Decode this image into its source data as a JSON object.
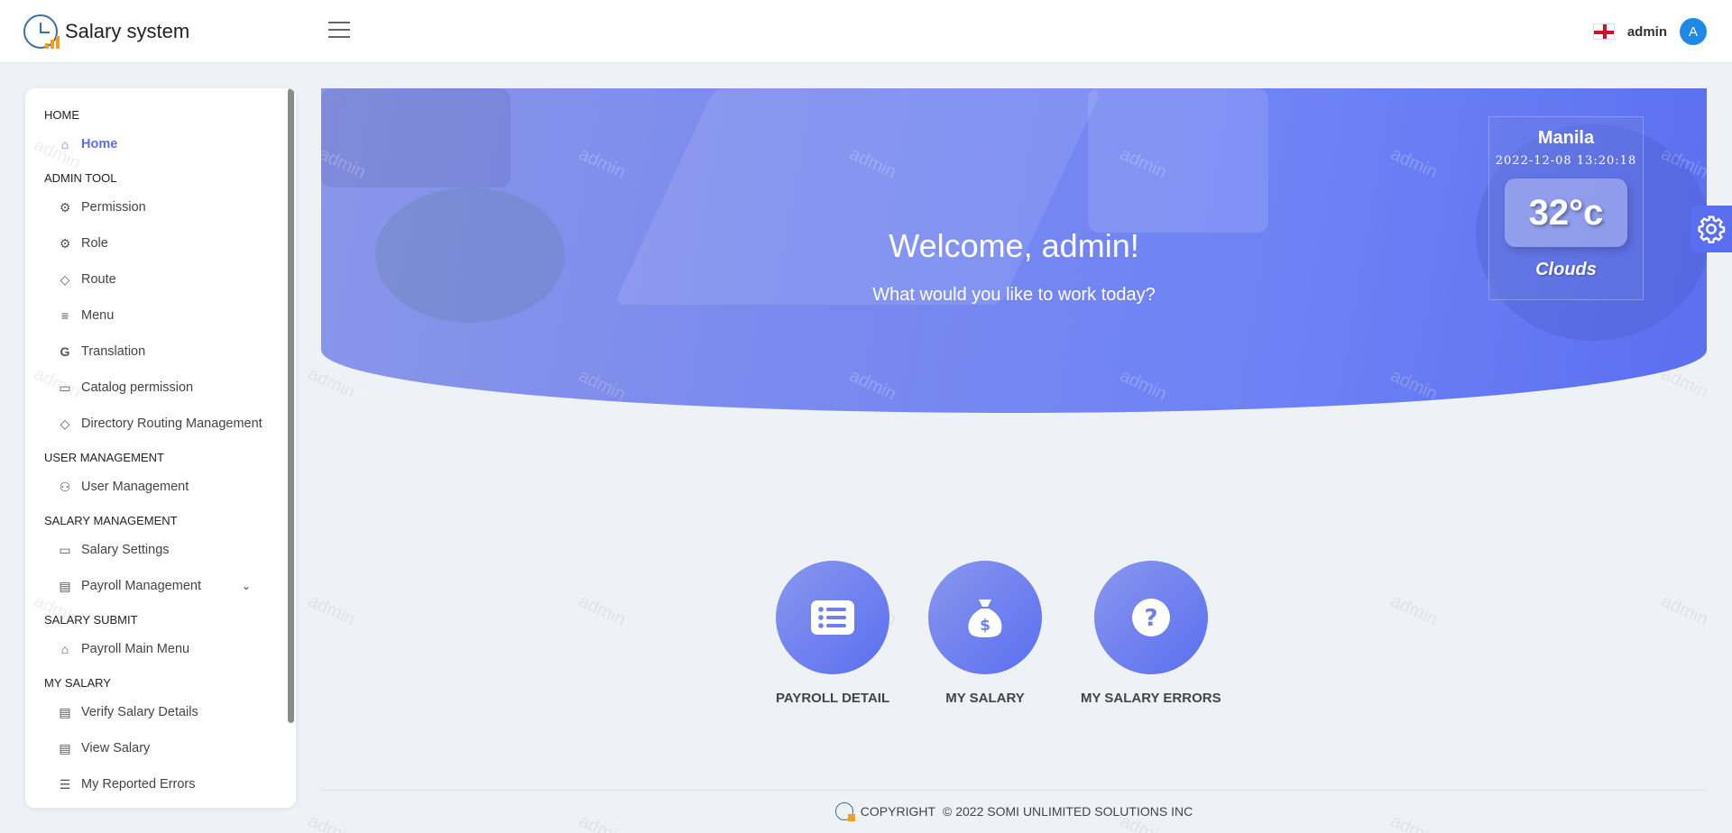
{
  "app": {
    "title": "Salary system"
  },
  "header": {
    "user_name": "admin",
    "avatar_initial": "A",
    "language_icon": "england-flag-icon",
    "menu_icon": "hamburger-icon"
  },
  "sidebar": {
    "sections": [
      {
        "title": "HOME",
        "items": [
          {
            "label": "Home",
            "icon": "home-icon",
            "active": true
          }
        ]
      },
      {
        "title": "ADMIN TOOL",
        "items": [
          {
            "label": "Permission",
            "icon": "gear-icon"
          },
          {
            "label": "Role",
            "icon": "gear-icon"
          },
          {
            "label": "Route",
            "icon": "diamond-icon"
          },
          {
            "label": "Menu",
            "icon": "menu-lines-icon"
          },
          {
            "label": "Translation",
            "icon": "google-icon"
          },
          {
            "label": "Catalog permission",
            "icon": "folder-icon"
          },
          {
            "label": "Directory Routing Management",
            "icon": "diamond-icon"
          }
        ]
      },
      {
        "title": "USER MANAGEMENT",
        "items": [
          {
            "label": "User Management",
            "icon": "users-icon"
          }
        ]
      },
      {
        "title": "SALARY MANAGEMENT",
        "items": [
          {
            "label": "Salary Settings",
            "icon": "card-icon"
          },
          {
            "label": "Payroll Management",
            "icon": "document-icon",
            "expandable": true
          }
        ]
      },
      {
        "title": "SALARY SUBMIT",
        "items": [
          {
            "label": "Payroll Main Menu",
            "icon": "home-icon"
          }
        ]
      },
      {
        "title": "MY SALARY",
        "items": [
          {
            "label": "Verify Salary Details",
            "icon": "document-icon"
          },
          {
            "label": "View Salary",
            "icon": "document-icon"
          },
          {
            "label": "My Reported Errors",
            "icon": "table-icon"
          }
        ]
      }
    ]
  },
  "hero": {
    "title": "Welcome, admin!",
    "subtitle": "What would you like to work today?",
    "watermark": "admin"
  },
  "weather": {
    "city": "Manila",
    "datetime": "2022-12-08 13:20:18",
    "temperature": "32°c",
    "condition": "Clouds"
  },
  "actions": [
    {
      "label": "PAYROLL DETAIL",
      "icon": "list-icon"
    },
    {
      "label": "MY SALARY",
      "icon": "money-bag-icon"
    },
    {
      "label": "MY SALARY ERRORS",
      "icon": "question-icon"
    }
  ],
  "footer": {
    "copyright_label": "COPYRIGHT",
    "copyright_text": "© 2022 SOMI UNLIMITED SOLUTIONS INC"
  },
  "colors": {
    "accent": "#5a6ff0",
    "avatar": "#1e88e5",
    "background": "#eef1f6"
  }
}
